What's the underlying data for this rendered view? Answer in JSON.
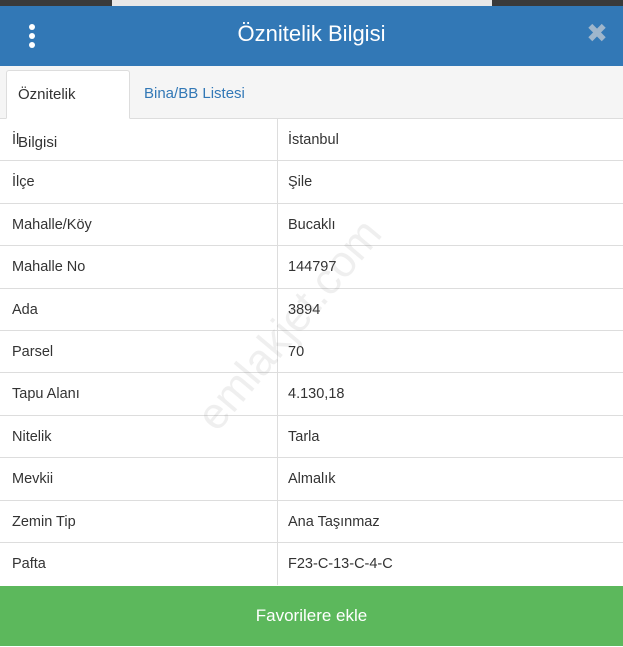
{
  "header": {
    "title": "Öznitelik Bilgisi",
    "close_glyph": "✖"
  },
  "tabs": [
    {
      "label": "Öznitelik Bilgisi",
      "active": true
    },
    {
      "label": "Bina/BB Listesi",
      "active": false
    }
  ],
  "rows": [
    {
      "key": "İl",
      "value": "İstanbul"
    },
    {
      "key": "İlçe",
      "value": "Şile"
    },
    {
      "key": "Mahalle/Köy",
      "value": "Bucaklı"
    },
    {
      "key": "Mahalle No",
      "value": "144797"
    },
    {
      "key": "Ada",
      "value": "3894"
    },
    {
      "key": "Parsel",
      "value": "70"
    },
    {
      "key": "Tapu Alanı",
      "value": "4.130,18"
    },
    {
      "key": "Nitelik",
      "value": "Tarla"
    },
    {
      "key": "Mevkii",
      "value": "Almalık"
    },
    {
      "key": "Zemin Tip",
      "value": "Ana Taşınmaz"
    },
    {
      "key": "Pafta",
      "value": "F23-C-13-C-4-C"
    }
  ],
  "watermark": "emlakjet.com",
  "footer": {
    "button_label": "Favorilere ekle"
  },
  "colors": {
    "header": "#3278b6",
    "button": "#5cb85c",
    "tab_link": "#3278b6"
  },
  "icons": {
    "menu": "kebab-menu-icon",
    "close": "close-icon"
  }
}
